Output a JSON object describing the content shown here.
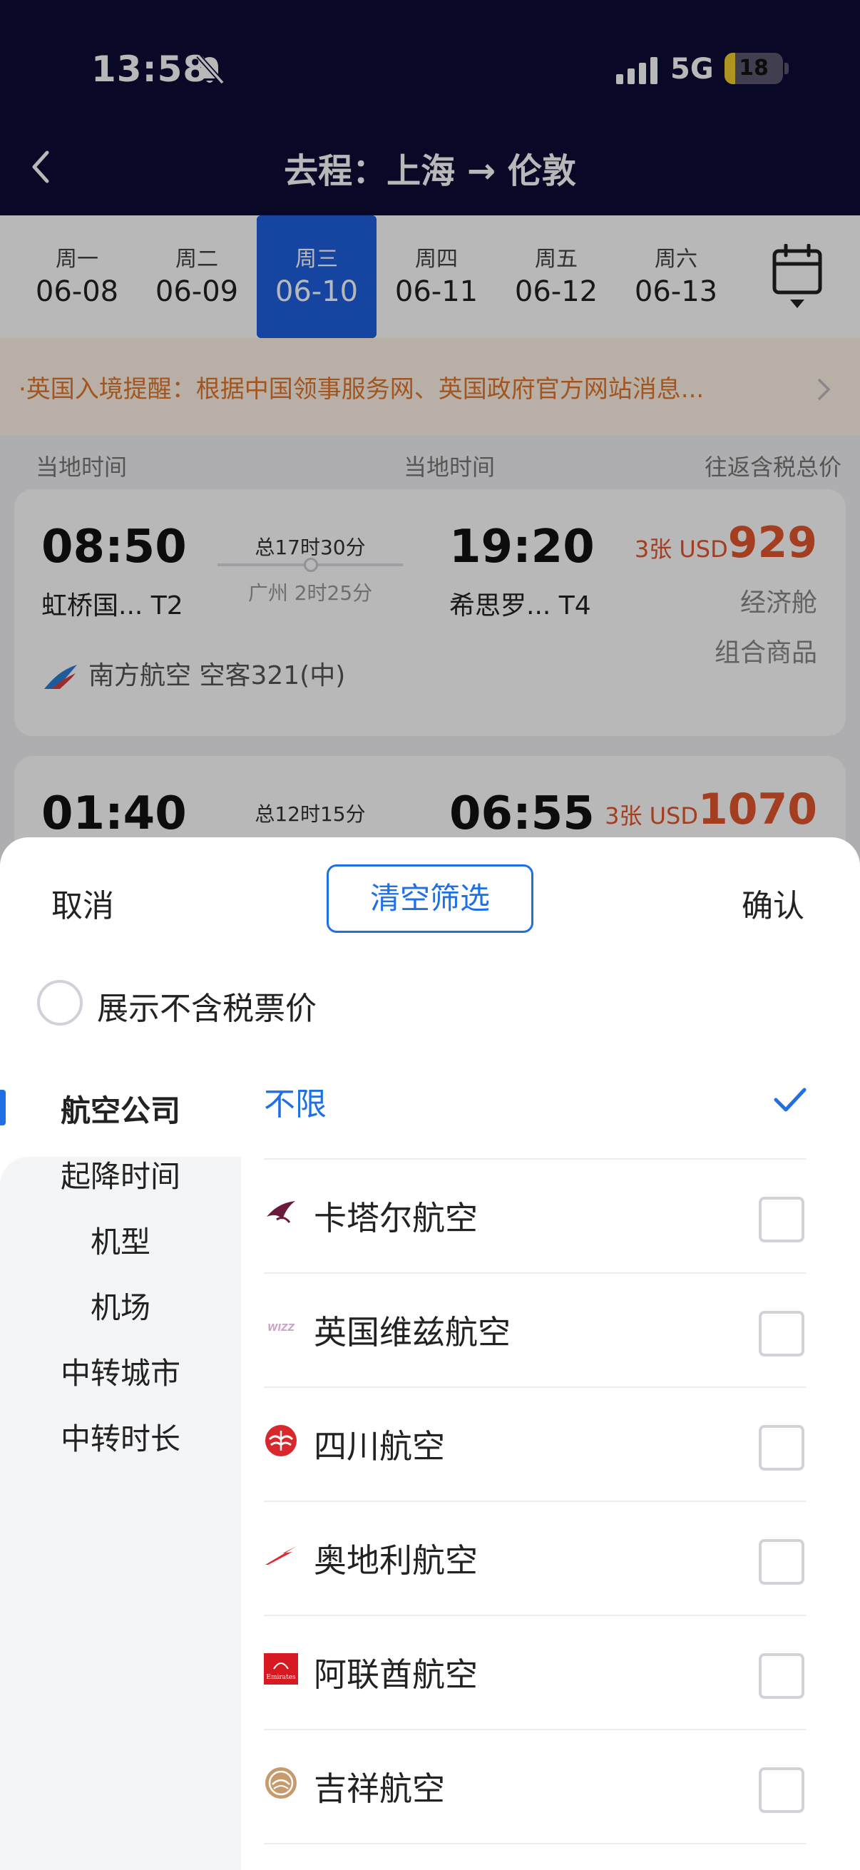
{
  "status_bar": {
    "time": "13:58",
    "network": "5G",
    "battery": "18",
    "battery_level": 0.18
  },
  "header": {
    "title": "去程：上海 → 伦敦"
  },
  "dates": [
    {
      "weekday": "周一",
      "date": "06-08"
    },
    {
      "weekday": "周二",
      "date": "06-09"
    },
    {
      "weekday": "周三",
      "date": "06-10",
      "selected": true
    },
    {
      "weekday": "周四",
      "date": "06-11"
    },
    {
      "weekday": "周五",
      "date": "06-12"
    },
    {
      "weekday": "周六",
      "date": "06-13"
    }
  ],
  "notice": "·英国入境提醒：根据中国领事服务网、英国政府官方网站消息...",
  "columns": {
    "departure": "当地时间",
    "arrival": "当地时间",
    "price": "往返含税总价"
  },
  "flights": [
    {
      "dep_time": "08:50",
      "dep_airport": "虹桥国... T2",
      "arr_time": "19:20",
      "arr_airport": "希思罗... T4",
      "duration": "总17时30分",
      "stopover": "广州 2时25分",
      "price_prefix": "3张 USD",
      "price": "929",
      "cabin": "经济舱",
      "package": "组合商品",
      "airline": "南方航空  空客321(中)"
    },
    {
      "dep_time": "01:40",
      "arr_time": "06:55",
      "duration": "总12时15分",
      "price_prefix": "3张 USD",
      "price": "1070"
    }
  ],
  "sheet": {
    "cancel": "取消",
    "clear": "清空筛选",
    "confirm": "确认",
    "tax_label": "展示不含税票价",
    "categories": [
      "航空公司",
      "起降时间",
      "机型",
      "机场",
      "中转城市",
      "中转时长"
    ],
    "unlimited": "不限",
    "airlines": [
      "卡塔尔航空",
      "英国维兹航空",
      "四川航空",
      "奥地利航空",
      "阿联酋航空",
      "吉祥航空"
    ],
    "logo_texts": {
      "wizz": "WIZZ",
      "emirates": "Emirates"
    }
  },
  "colors": {
    "accent": "#1f6fe5",
    "header_bg": "#0f0c36",
    "price": "#e4572e",
    "notice_text": "#e2762c"
  }
}
